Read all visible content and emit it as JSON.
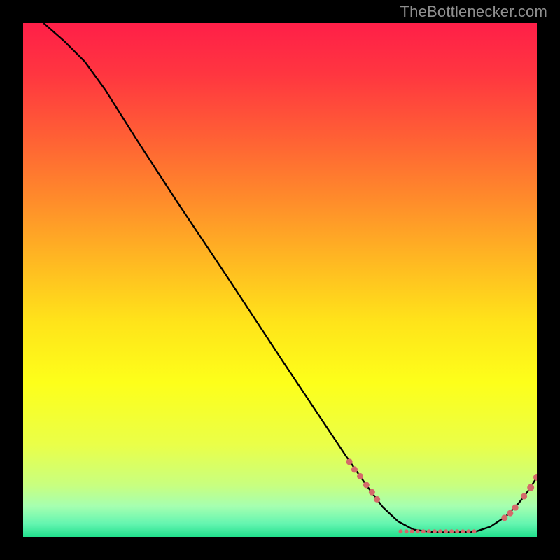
{
  "attribution": "TheBottlenecker.com",
  "chart_data": {
    "type": "line",
    "title": "",
    "xlabel": "",
    "ylabel": "",
    "xlim": [
      0,
      100
    ],
    "ylim": [
      0,
      100
    ],
    "background": {
      "type": "vertical_gradient",
      "stops": [
        {
          "pos": 0.0,
          "color": "#ff1f48"
        },
        {
          "pos": 0.1,
          "color": "#ff3640"
        },
        {
          "pos": 0.22,
          "color": "#ff5f35"
        },
        {
          "pos": 0.34,
          "color": "#ff8a2b"
        },
        {
          "pos": 0.46,
          "color": "#ffb722"
        },
        {
          "pos": 0.58,
          "color": "#ffe31a"
        },
        {
          "pos": 0.7,
          "color": "#fdff1a"
        },
        {
          "pos": 0.82,
          "color": "#eaff48"
        },
        {
          "pos": 0.9,
          "color": "#c8ff80"
        },
        {
          "pos": 0.94,
          "color": "#a6ffb0"
        },
        {
          "pos": 0.975,
          "color": "#63f5b0"
        },
        {
          "pos": 1.0,
          "color": "#22e08d"
        }
      ]
    },
    "curve": [
      {
        "x": 4.0,
        "y": 100.0
      },
      {
        "x": 8.0,
        "y": 96.5
      },
      {
        "x": 12.0,
        "y": 92.5
      },
      {
        "x": 16.0,
        "y": 87.0
      },
      {
        "x": 22.0,
        "y": 77.5
      },
      {
        "x": 30.0,
        "y": 65.2
      },
      {
        "x": 40.0,
        "y": 50.2
      },
      {
        "x": 50.0,
        "y": 35.0
      },
      {
        "x": 58.0,
        "y": 23.0
      },
      {
        "x": 63.0,
        "y": 15.5
      },
      {
        "x": 67.0,
        "y": 9.8
      },
      {
        "x": 70.0,
        "y": 5.8
      },
      {
        "x": 73.0,
        "y": 3.0
      },
      {
        "x": 76.0,
        "y": 1.4
      },
      {
        "x": 80.0,
        "y": 0.9
      },
      {
        "x": 84.0,
        "y": 0.9
      },
      {
        "x": 88.0,
        "y": 1.0
      },
      {
        "x": 91.0,
        "y": 2.0
      },
      {
        "x": 94.0,
        "y": 4.0
      },
      {
        "x": 96.5,
        "y": 6.6
      },
      {
        "x": 98.5,
        "y": 9.2
      },
      {
        "x": 100.0,
        "y": 11.6
      }
    ],
    "markers": [
      {
        "x": 63.5,
        "y": 14.6,
        "r": 4.5
      },
      {
        "x": 64.5,
        "y": 13.1,
        "r": 4.5
      },
      {
        "x": 65.6,
        "y": 11.8,
        "r": 4.5
      },
      {
        "x": 66.8,
        "y": 10.1,
        "r": 4.5
      },
      {
        "x": 67.9,
        "y": 8.7,
        "r": 4.5
      },
      {
        "x": 68.9,
        "y": 7.3,
        "r": 4.5
      },
      {
        "x": 73.5,
        "y": 1.05,
        "r": 3.0
      },
      {
        "x": 74.6,
        "y": 1.05,
        "r": 3.0
      },
      {
        "x": 75.7,
        "y": 1.05,
        "r": 3.0
      },
      {
        "x": 76.8,
        "y": 1.05,
        "r": 3.0
      },
      {
        "x": 77.9,
        "y": 1.05,
        "r": 3.0
      },
      {
        "x": 79.0,
        "y": 1.05,
        "r": 3.0
      },
      {
        "x": 80.1,
        "y": 1.05,
        "r": 3.0
      },
      {
        "x": 81.2,
        "y": 1.05,
        "r": 3.0
      },
      {
        "x": 82.3,
        "y": 1.05,
        "r": 3.0
      },
      {
        "x": 83.4,
        "y": 1.05,
        "r": 3.0
      },
      {
        "x": 84.5,
        "y": 1.05,
        "r": 3.0
      },
      {
        "x": 85.6,
        "y": 1.05,
        "r": 3.0
      },
      {
        "x": 86.7,
        "y": 1.05,
        "r": 3.0
      },
      {
        "x": 87.8,
        "y": 1.05,
        "r": 3.0
      },
      {
        "x": 93.7,
        "y": 3.7,
        "r": 4.5
      },
      {
        "x": 94.8,
        "y": 4.6,
        "r": 4.5
      },
      {
        "x": 95.8,
        "y": 5.7,
        "r": 4.5
      },
      {
        "x": 97.5,
        "y": 7.9,
        "r": 4.5
      },
      {
        "x": 98.8,
        "y": 9.6,
        "r": 5.0
      },
      {
        "x": 100.0,
        "y": 11.6,
        "r": 5.0
      }
    ],
    "marker_color": "#d46a6a",
    "curve_color": "#000000"
  }
}
